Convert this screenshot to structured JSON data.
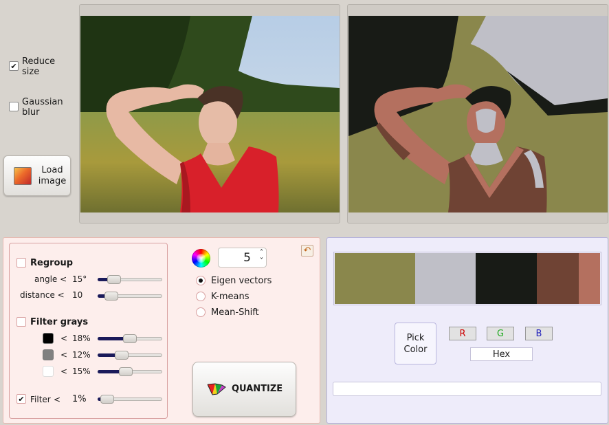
{
  "options": {
    "reduce_size": {
      "label": "Reduce size",
      "checked": true
    },
    "gaussian_blur": {
      "label": "Gaussian blur",
      "checked": false
    }
  },
  "load_button": {
    "label": "Load image",
    "icon": "image-icon"
  },
  "regroup": {
    "label": "Regroup",
    "checked": false,
    "angle": {
      "label": "angle <",
      "value": "15°",
      "level": 0.18
    },
    "distance": {
      "label": "distance <",
      "value": "10",
      "level": 0.12
    }
  },
  "filter_grays": {
    "label": "Filter grays",
    "checked": false,
    "rows": [
      {
        "swatch": "#000000",
        "op": "<",
        "value": "18%",
        "level": 0.5
      },
      {
        "swatch": "#808080",
        "op": "<",
        "value": "12%",
        "level": 0.33
      },
      {
        "swatch": "#ffffff",
        "op": "<",
        "value": "15%",
        "level": 0.41
      }
    ]
  },
  "filter": {
    "label": "Filter",
    "op": "<",
    "value": "1%",
    "checked": true,
    "level": 0.04
  },
  "color_count": {
    "value": "5",
    "icon": "color-wheel-icon"
  },
  "undo_icon": "undo-icon",
  "methods": [
    {
      "label": "Eigen vectors",
      "selected": true
    },
    {
      "label": "K-means",
      "selected": false
    },
    {
      "label": "Mean-Shift",
      "selected": false
    }
  ],
  "quantize_button": {
    "label": "QUANTIZE",
    "icon": "quantize-icon"
  },
  "palette": [
    {
      "color": "#8a874c",
      "fraction": 0.31
    },
    {
      "color": "#bfbfc7",
      "fraction": 0.233
    },
    {
      "color": "#181b16",
      "fraction": 0.233
    },
    {
      "color": "#6f4334",
      "fraction": 0.163
    },
    {
      "color": "#b4705f",
      "fraction": 0.081
    }
  ],
  "pick_button": {
    "label": "Pick Color"
  },
  "channels": {
    "r": "R",
    "g": "G",
    "b": "B",
    "r_color": "#cc0000",
    "g_color": "#22aa22",
    "b_color": "#2222bb"
  },
  "hex_field": {
    "value": "Hex"
  },
  "status_field": {
    "value": ""
  }
}
